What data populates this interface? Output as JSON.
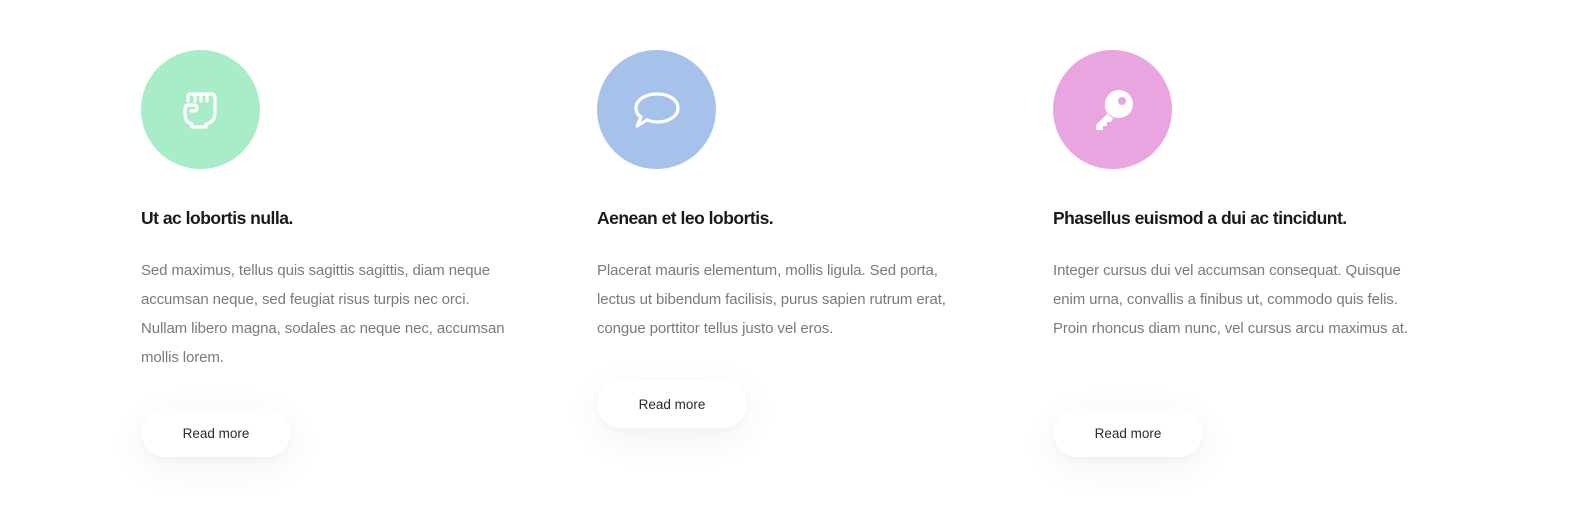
{
  "features": [
    {
      "icon": "fist-icon",
      "icon_color": "#a8ecc8",
      "title": "Ut ac lobortis nulla.",
      "description": "Sed maximus, tellus quis sagittis sagittis, diam neque accumsan neque, sed feugiat risus turpis nec orci. Nullam libero magna, sodales ac neque nec, accumsan mollis lorem.",
      "button_label": "Read more"
    },
    {
      "icon": "speech-bubble-icon",
      "icon_color": "#a7c2ea",
      "title": "Aenean et leo lobortis.",
      "description": "Placerat mauris elementum, mollis ligula. Sed porta, lectus ut bibendum facilisis, purus sapien rutrum erat, congue porttitor tellus justo vel eros.",
      "button_label": "Read more"
    },
    {
      "icon": "key-icon",
      "icon_color": "#e8a5e0",
      "title": "Phasellus euismod a dui ac tincidunt.",
      "description": "Integer cursus dui vel accumsan consequat. Quisque enim urna, convallis a finibus ut, commodo quis felis. Proin rhoncus diam nunc, vel cursus arcu maximus at.",
      "button_label": "Read more"
    }
  ]
}
